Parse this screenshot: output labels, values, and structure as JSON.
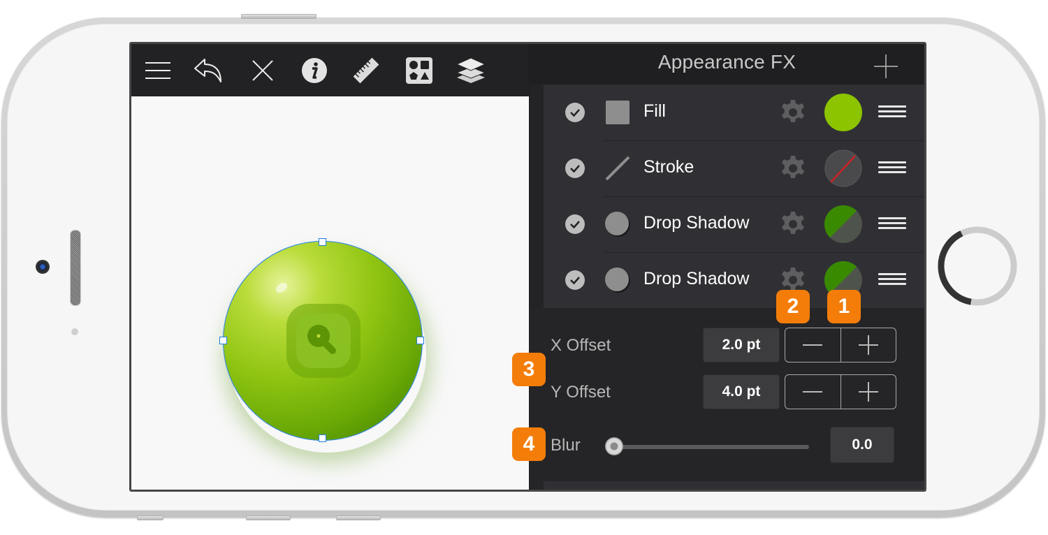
{
  "device": {
    "type": "phone-landscape",
    "home_button_progress": 0.4
  },
  "toolbar": {
    "items": [
      {
        "icon": "menu-icon",
        "label": "Menu"
      },
      {
        "icon": "undo-icon",
        "label": "Undo"
      },
      {
        "icon": "close-icon",
        "label": "Close"
      },
      {
        "icon": "info-icon",
        "label": "Info"
      },
      {
        "icon": "ruler-icon",
        "label": "Measure"
      },
      {
        "icon": "shapes-icon",
        "label": "Shapes"
      },
      {
        "icon": "layers-icon",
        "label": "Layers"
      }
    ]
  },
  "canvas": {
    "object": "green-sphere-app-icon",
    "selection_color": "#1e7de0"
  },
  "panel": {
    "title": "Appearance FX",
    "add_icon": "plus-icon",
    "effects": [
      {
        "label": "Fill",
        "enabled": true,
        "type_icon": "fill-square-icon",
        "swatch": {
          "kind": "solid",
          "color": "#8cc400"
        }
      },
      {
        "label": "Stroke",
        "enabled": true,
        "type_icon": "stroke-line-icon",
        "swatch": {
          "kind": "none",
          "color": "#4a4a4c",
          "slash": "#cc2222"
        }
      },
      {
        "label": "Drop Shadow",
        "enabled": true,
        "type_icon": "shadow-circle-icon",
        "swatch": {
          "kind": "split",
          "color": "#3a8a00",
          "alt": "#4e544c"
        }
      },
      {
        "label": "Drop Shadow",
        "enabled": true,
        "type_icon": "shadow-circle-icon",
        "swatch": {
          "kind": "split",
          "color": "#3a8a00",
          "alt": "#4e544c"
        }
      }
    ]
  },
  "properties": {
    "x_offset": {
      "label": "X Offset",
      "value": "2.0 pt"
    },
    "y_offset": {
      "label": "Y Offset",
      "value": "4.0 pt"
    },
    "blur": {
      "label": "Blur",
      "value": "0.0",
      "slider_fraction": 0.0
    }
  },
  "badges": [
    {
      "number": "1",
      "color": "#f47d0a"
    },
    {
      "number": "2",
      "color": "#f47d0a"
    },
    {
      "number": "3",
      "color": "#f47d0a"
    },
    {
      "number": "4",
      "color": "#f47d0a"
    }
  ]
}
